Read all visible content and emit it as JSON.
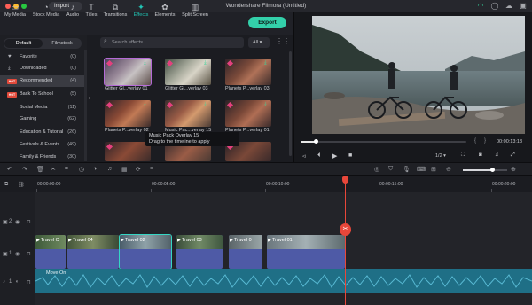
{
  "titlebar": {
    "import_label": "Import",
    "app_title": "Wondershare Filmora (Untitled)"
  },
  "media_tabs": [
    {
      "label": "My Media",
      "icon": "folder-icon"
    },
    {
      "label": "Stock Media",
      "icon": "cloud-icon"
    },
    {
      "label": "Audio",
      "icon": "music-note-icon"
    },
    {
      "label": "Titles",
      "icon": "text-icon"
    },
    {
      "label": "Transitions",
      "icon": "transition-icon"
    },
    {
      "label": "Effects",
      "icon": "effects-icon",
      "active": true
    },
    {
      "label": "Elements",
      "icon": "elements-icon"
    },
    {
      "label": "Split Screen",
      "icon": "split-screen-icon"
    }
  ],
  "export_label": "Export",
  "library": {
    "tab_default": "Default",
    "tab_filmstock": "Filmstock"
  },
  "categories": [
    {
      "label": "Favorite",
      "count": "(0)",
      "icon": "heart-icon"
    },
    {
      "label": "Downloaded",
      "count": "(0)",
      "icon": "download-icon"
    },
    {
      "label": "Recommended",
      "count": "(4)",
      "hot": "HOT",
      "active": true
    },
    {
      "label": "Back To School",
      "count": "(5)",
      "hot": "HOT"
    },
    {
      "label": "Social Media",
      "count": "(11)"
    },
    {
      "label": "Gaming",
      "count": "(62)"
    },
    {
      "label": "Education & Tutorial",
      "count": "(26)"
    },
    {
      "label": "Festivals & Events",
      "count": "(49)"
    },
    {
      "label": "Family & Friends",
      "count": "(30)"
    }
  ],
  "effects_panel": {
    "search_placeholder": "Search effects",
    "filter_value": "All"
  },
  "effects": [
    {
      "label": "Glitter Gl...verlay 01"
    },
    {
      "label": "Glitter Gl...verlay 03"
    },
    {
      "label": "Planets P...verlay 03"
    },
    {
      "label": "Planets P...verlay 02"
    },
    {
      "label": "Music Pac...verlay 15"
    },
    {
      "label": "Planets P...verlay 01"
    },
    {
      "label": ""
    },
    {
      "label": ""
    },
    {
      "label": ""
    }
  ],
  "tooltip": {
    "line1": "Music Pack Overlay 15",
    "line2": "Drag to the timeline to apply"
  },
  "preview": {
    "time": "00:00:13:13",
    "ratio": "1/2"
  },
  "ruler": [
    "00:00:00:00",
    "00:00:05:00",
    "00:00:10:00",
    "00:00:15:00",
    "00:00:20:00"
  ],
  "clips": [
    {
      "label": "Travel C"
    },
    {
      "label": "Travel 04"
    },
    {
      "label": "Travel 02"
    },
    {
      "label": "Travel 03"
    },
    {
      "label": "Travel 0"
    },
    {
      "label": "Travel 01"
    }
  ],
  "audio": {
    "label": "Move On"
  },
  "track_labels": {
    "t2": "2",
    "t1": "1",
    "a1": "1"
  },
  "colors": {
    "accent": "#22c6b6",
    "export": "#33d0aa",
    "playhead": "#e8473a",
    "clip": "#4e5aa6",
    "audio": "#1f6f86"
  }
}
